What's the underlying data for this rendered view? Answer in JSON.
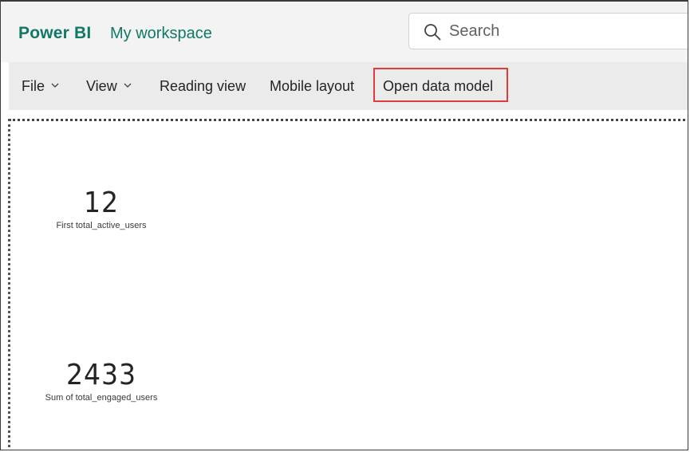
{
  "header": {
    "brand": "Power BI",
    "workspace": "My workspace",
    "search": {
      "placeholder": "Search",
      "icon": "search-icon"
    }
  },
  "toolbar": {
    "items": [
      {
        "label": "File",
        "has_dropdown": true
      },
      {
        "label": "View",
        "has_dropdown": true
      },
      {
        "label": "Reading view"
      },
      {
        "label": "Mobile layout"
      },
      {
        "label": "Open data model",
        "highlighted": true
      }
    ]
  },
  "cards": [
    {
      "value": "12",
      "label": "First total_active_users"
    },
    {
      "value": "2433",
      "label": "Sum of total_engaged_users"
    }
  ],
  "colors": {
    "brand": "#117865",
    "highlight": "#e03c3c",
    "toolbar_bg": "#ebebeb",
    "header_bg": "#f3f3f3"
  }
}
